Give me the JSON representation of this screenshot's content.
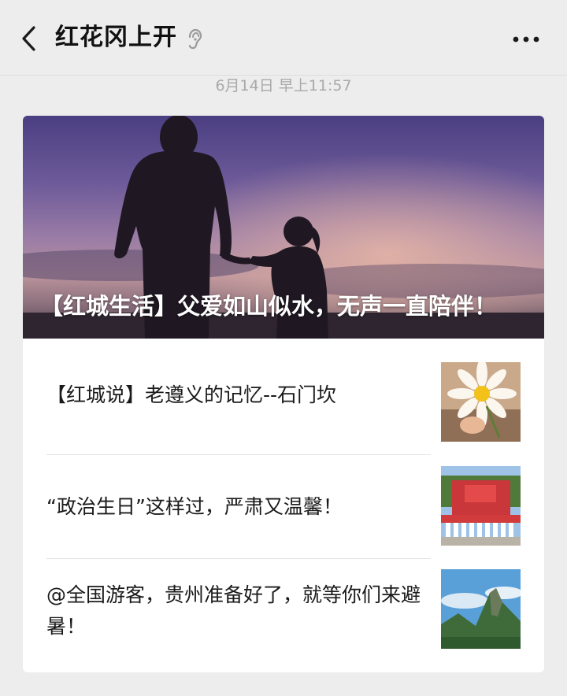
{
  "header": {
    "back_icon": "chevron-left-icon",
    "title": "红花冈上开",
    "ear_icon": "ear-icon",
    "more_icon": "more-dots-icon"
  },
  "timestamp": "6月14日 早上11:57",
  "card": {
    "hero": {
      "title": "【红城生活】父爱如山似水，无声一直陪伴！",
      "image": "father-daughter-silhouette-sunset"
    },
    "articles": [
      {
        "title": "【红城说】老遵义的记忆--石门坎",
        "thumbnail": "daisy-flower-hand"
      },
      {
        "title": "“政治生日”这样过，严肃又温馨！",
        "thumbnail": "group-photo-party-flag"
      },
      {
        "title": "@全国游客，贵州准备好了，就等你们来避暑！",
        "thumbnail": "mountain-peak-landscape"
      }
    ]
  },
  "colors": {
    "background": "#ededed",
    "card": "#ffffff",
    "timestamp": "#a9a9a9",
    "text": "#1a1a1a"
  }
}
